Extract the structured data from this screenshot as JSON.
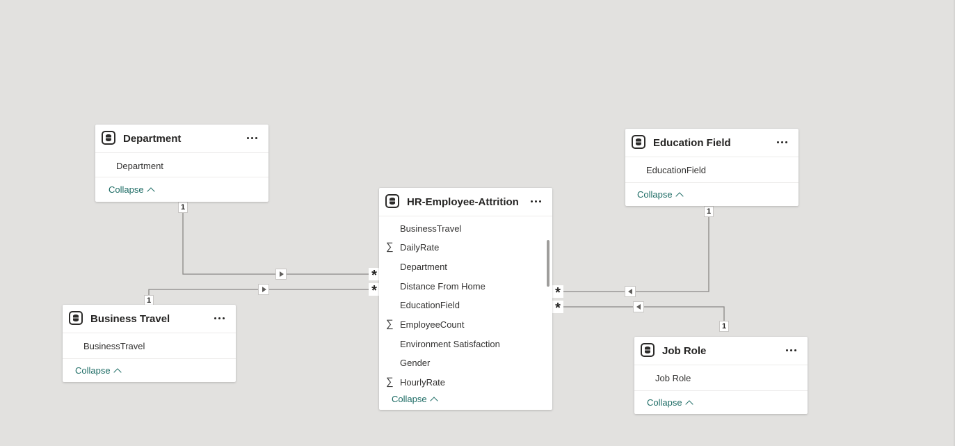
{
  "tables": {
    "department": {
      "title": "Department",
      "fields": [
        "Department"
      ],
      "collapse_label": "Collapse"
    },
    "business_travel": {
      "title": "Business Travel",
      "fields": [
        "BusinessTravel"
      ],
      "collapse_label": "Collapse"
    },
    "hr_employee_attrition": {
      "title": "HR-Employee-Attrition",
      "fields": [
        {
          "name": "BusinessTravel",
          "sigma": false
        },
        {
          "name": "DailyRate",
          "sigma": true
        },
        {
          "name": "Department",
          "sigma": false
        },
        {
          "name": "Distance From Home",
          "sigma": false
        },
        {
          "name": "EducationField",
          "sigma": false
        },
        {
          "name": "EmployeeCount",
          "sigma": true
        },
        {
          "name": "Environment Satisfaction",
          "sigma": false
        },
        {
          "name": "Gender",
          "sigma": false
        },
        {
          "name": "HourlyRate",
          "sigma": true
        }
      ],
      "sigma_symbol": "∑",
      "collapse_label": "Collapse"
    },
    "education_field": {
      "title": "Education Field",
      "fields": [
        "EducationField"
      ],
      "collapse_label": "Collapse"
    },
    "job_role": {
      "title": "Job Role",
      "fields": [
        "Job Role"
      ],
      "collapse_label": "Collapse"
    }
  },
  "relationships": {
    "one_symbol": "1",
    "many_symbol": "*"
  },
  "icons": {
    "table": "table-icon",
    "more": "more-options-icon",
    "collapse": "chevron-up-icon",
    "filter_direction_right": "triangle-right-icon",
    "filter_direction_left": "triangle-left-icon"
  },
  "colors": {
    "canvas": "#e2e1df",
    "link": "#1c6b64",
    "line": "#8a8886"
  }
}
